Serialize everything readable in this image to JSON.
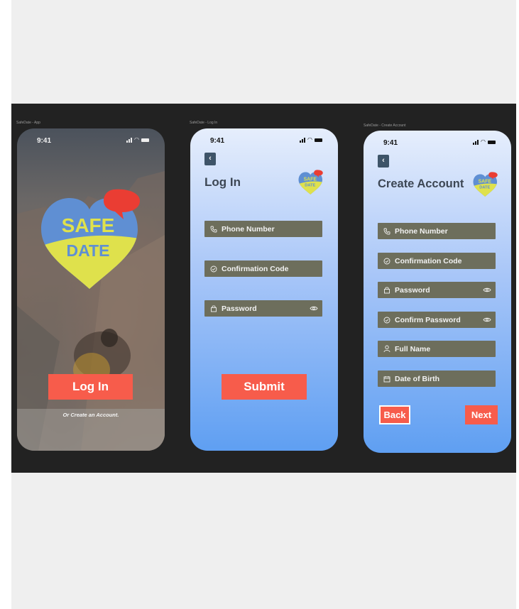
{
  "colors": {
    "accent": "#f75c4b",
    "field_bg": "#6d6e5c",
    "board_bg": "#222222",
    "heart_blue": "#5f8fd3",
    "heart_yellow": "#dfe14c",
    "speech_red": "#ea3d33"
  },
  "frames": [
    {
      "label": "SafeDate - App"
    },
    {
      "label": "SafeDate - Log In"
    },
    {
      "label": "SafeDate - Create Account"
    }
  ],
  "status_bar": {
    "time": "9:41",
    "icons": [
      "signal-icon",
      "wifi-icon",
      "battery-icon"
    ]
  },
  "logo": {
    "line1": "SAFE",
    "line2": "DATE"
  },
  "app_screen": {
    "login_button": "Log In",
    "create_link": "Or Create an Account."
  },
  "login_screen": {
    "back_glyph": "‹",
    "title": "Log In",
    "fields": [
      {
        "label": "Phone Number",
        "icon": "phone-icon"
      },
      {
        "label": "Confirmation Code",
        "icon": "check-circle-icon"
      },
      {
        "label": "Password",
        "icon": "lock-icon",
        "trailing_icon": "eye-icon"
      }
    ],
    "submit_button": "Submit"
  },
  "create_screen": {
    "back_glyph": "‹",
    "title": "Create Account",
    "fields": [
      {
        "label": "Phone Number",
        "icon": "phone-icon"
      },
      {
        "label": "Confirmation Code",
        "icon": "check-circle-icon"
      },
      {
        "label": "Password",
        "icon": "lock-icon",
        "trailing_icon": "eye-icon"
      },
      {
        "label": "Confirm Password",
        "icon": "check-circle-icon",
        "trailing_icon": "eye-icon"
      },
      {
        "label": "Full Name",
        "icon": "person-icon"
      },
      {
        "label": "Date of Birth",
        "icon": "calendar-icon"
      }
    ],
    "back_button": "Back",
    "next_button": "Next"
  }
}
